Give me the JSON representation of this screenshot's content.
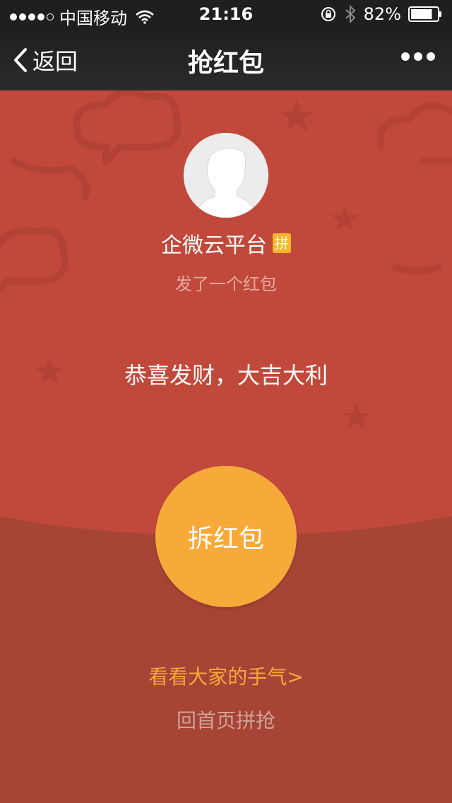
{
  "status_bar": {
    "carrier": "中国移动",
    "time": "21:16",
    "battery": "82%",
    "battery_level": 0.82
  },
  "nav": {
    "back_label": "返回",
    "title": "抢红包"
  },
  "envelope": {
    "sender_name": "企微云平台",
    "badge": "拼",
    "subtitle": "发了一个红包",
    "greeting": "恭喜发财，大吉大利",
    "open_label": "拆红包",
    "luck_link": "看看大家的手气>",
    "home_link": "回首页拼抢"
  },
  "colors": {
    "status_bg": "#1f1f1f",
    "envelope_top": "#c0493b",
    "envelope_bottom": "#a64436",
    "open_button": "#f7a93a",
    "badge": "#f7b52a"
  }
}
